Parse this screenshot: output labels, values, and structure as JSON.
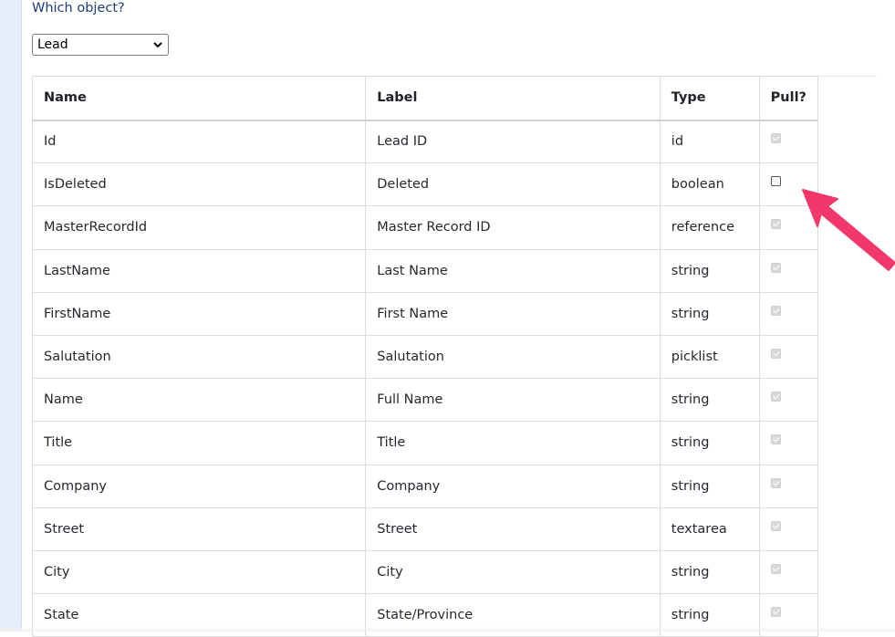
{
  "prompt": "Which object?",
  "object_select": {
    "selected": "Lead"
  },
  "table": {
    "headers": {
      "name": "Name",
      "label": "Label",
      "type": "Type",
      "pull": "Pull?"
    },
    "rows": [
      {
        "name": "Id",
        "label": "Lead ID",
        "type": "id",
        "pull": "checked-disabled"
      },
      {
        "name": "IsDeleted",
        "label": "Deleted",
        "type": "boolean",
        "pull": "unchecked"
      },
      {
        "name": "MasterRecordId",
        "label": "Master Record ID",
        "type": "reference",
        "pull": "checked-disabled"
      },
      {
        "name": "LastName",
        "label": "Last Name",
        "type": "string",
        "pull": "checked-disabled"
      },
      {
        "name": "FirstName",
        "label": "First Name",
        "type": "string",
        "pull": "checked-disabled"
      },
      {
        "name": "Salutation",
        "label": "Salutation",
        "type": "picklist",
        "pull": "checked-disabled"
      },
      {
        "name": "Name",
        "label": "Full Name",
        "type": "string",
        "pull": "checked-disabled"
      },
      {
        "name": "Title",
        "label": "Title",
        "type": "string",
        "pull": "checked-disabled"
      },
      {
        "name": "Company",
        "label": "Company",
        "type": "string",
        "pull": "checked-disabled"
      },
      {
        "name": "Street",
        "label": "Street",
        "type": "textarea",
        "pull": "checked-disabled"
      },
      {
        "name": "City",
        "label": "City",
        "type": "string",
        "pull": "checked-disabled"
      },
      {
        "name": "State",
        "label": "State/Province",
        "type": "string",
        "pull": "checked-disabled"
      }
    ]
  },
  "annotation": {
    "arrow_color": "#f2386b",
    "icon": "arrow-pointer-icon"
  },
  "colors": {
    "prompt_text": "#1d3f7a",
    "gutter": "#e6eef9"
  }
}
